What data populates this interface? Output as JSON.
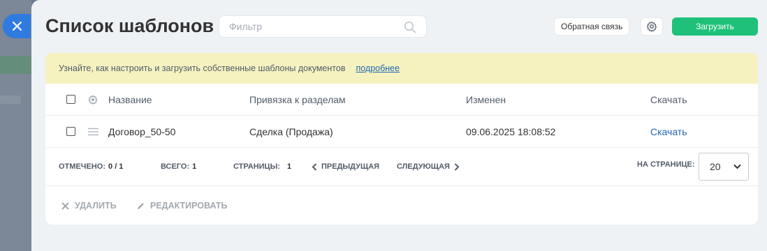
{
  "header": {
    "title": "Список шаблонов",
    "filter_placeholder": "Фильтр",
    "feedback_label": "Обратная связь",
    "upload_label": "Загрузить"
  },
  "notice": {
    "text": "Узнайте, как настроить и загрузить собственные шаблоны документов",
    "link": "подробнее"
  },
  "table": {
    "columns": [
      "Название",
      "Привязка к разделам",
      "Изменен",
      "Скачать"
    ],
    "rows": [
      {
        "name": "Договор_50-50",
        "sections": "Сделка (Продажа)",
        "modified": "09.06.2025 18:08:52",
        "download": "Скачать"
      }
    ]
  },
  "pager": {
    "marked_label": "ОТМЕЧЕНО:",
    "marked_value": "0 / 1",
    "total_label": "ВСЕГО:",
    "total_value": "1",
    "pages_label": "СТРАНИЦЫ:",
    "pages_value": "1",
    "prev_label": "ПРЕДЫДУЩАЯ",
    "next_label": "СЛЕДУЮЩАЯ",
    "per_page_label": "НА СТРАНИЦЕ:",
    "per_page_value": "20"
  },
  "actions": {
    "delete_label": "УДАЛИТЬ",
    "edit_label": "РЕДАКТИРОВАТЬ"
  },
  "colors": {
    "accent_blue": "#2f7be0",
    "upload_green": "#1fc17a",
    "notice_bg": "#f6f2c0",
    "link_blue": "#2067b0"
  }
}
